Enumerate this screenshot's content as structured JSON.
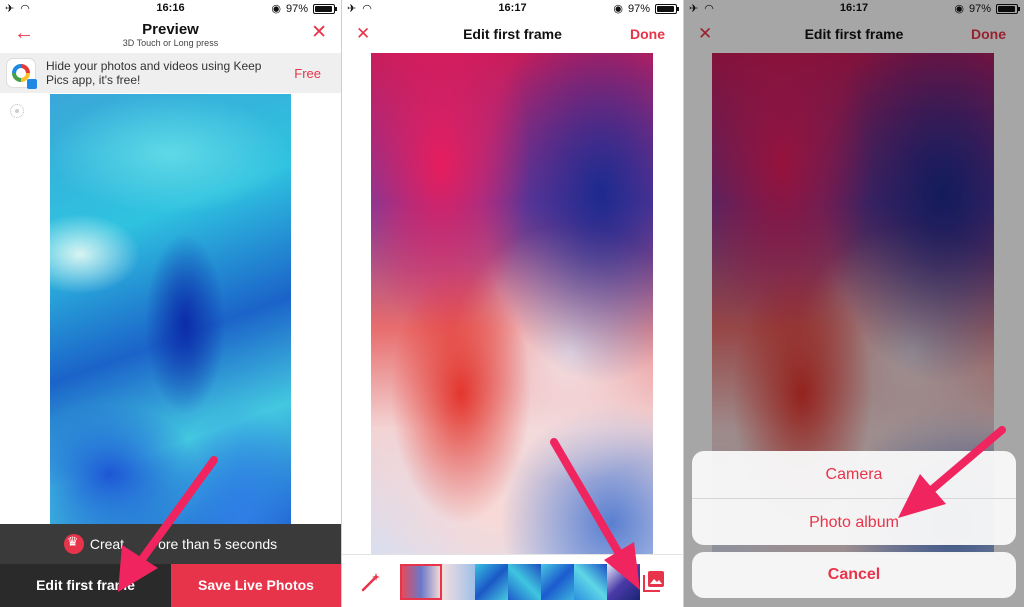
{
  "status": {
    "left_icons": [
      "airplane-icon",
      "wifi-icon"
    ],
    "battery": "97%",
    "times": [
      "16:16",
      "16:17",
      "16:17"
    ]
  },
  "panel1": {
    "title": "Preview",
    "subtitle": "3D Touch or Long press",
    "ad_text": "Hide your photos and videos using Keep Pics app, it's free!",
    "ad_action": "Free",
    "promo_left": "Creat",
    "promo_right": "ore than 5 seconds",
    "edit_button": "Edit first frame",
    "save_button": "Save Live Photos"
  },
  "panel2": {
    "title": "Edit first frame",
    "done": "Done"
  },
  "panel3": {
    "title": "Edit first frame",
    "done": "Done",
    "sheet_options": [
      "Camera",
      "Photo album"
    ],
    "cancel": "Cancel"
  },
  "colors": {
    "accent": "#e8344a",
    "arrow": "#f0245e",
    "dark_button": "#2a2a2a"
  }
}
